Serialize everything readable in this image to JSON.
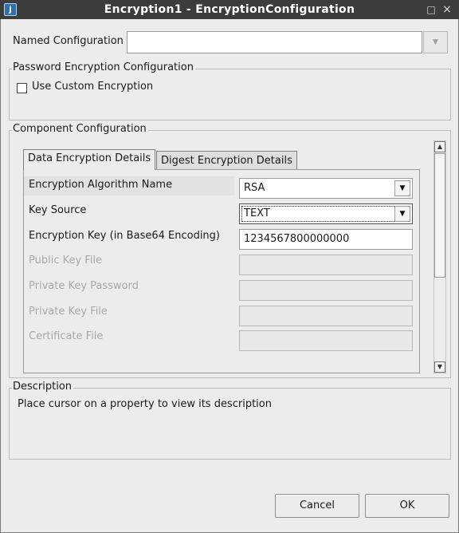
{
  "window": {
    "title": "Encryption1 - EncryptionConfiguration",
    "icon": "app-icon",
    "minimize_glyph": "□",
    "close_glyph": "×"
  },
  "named_configuration": {
    "label": "Named Configuration",
    "value": "",
    "arrow": "▼"
  },
  "password_group": {
    "legend": "Password Encryption Configuration",
    "checkbox_label": "Use Custom Encryption",
    "checked": false
  },
  "component_group": {
    "legend": "Component Configuration",
    "tabs": [
      {
        "label": "Data Encryption Details",
        "active": true
      },
      {
        "label": "Digest Encryption Details",
        "active": false
      }
    ],
    "properties": [
      {
        "label": "Encryption Algorithm Name",
        "value": "RSA",
        "enabled": true,
        "type": "dropdown"
      },
      {
        "label": "Key Source",
        "value": "TEXT",
        "enabled": true,
        "type": "dropdown"
      },
      {
        "label": "Encryption Key (in Base64 Encoding)",
        "value": "1234567800000000",
        "enabled": true,
        "type": "text"
      },
      {
        "label": "Public Key File",
        "value": "",
        "enabled": false,
        "type": "text"
      },
      {
        "label": "Private Key Password",
        "value": "",
        "enabled": false,
        "type": "text"
      },
      {
        "label": "Private Key File",
        "value": "",
        "enabled": false,
        "type": "text"
      },
      {
        "label": "Certificate File",
        "value": "",
        "enabled": false,
        "type": "text"
      }
    ],
    "dropdown_glyph": "▼",
    "scroll_up_glyph": "▲",
    "scroll_down_glyph": "▼"
  },
  "description_group": {
    "legend": "Description",
    "text": "Place cursor on a property to view its description"
  },
  "buttons": {
    "cancel": "Cancel",
    "ok": "OK"
  }
}
